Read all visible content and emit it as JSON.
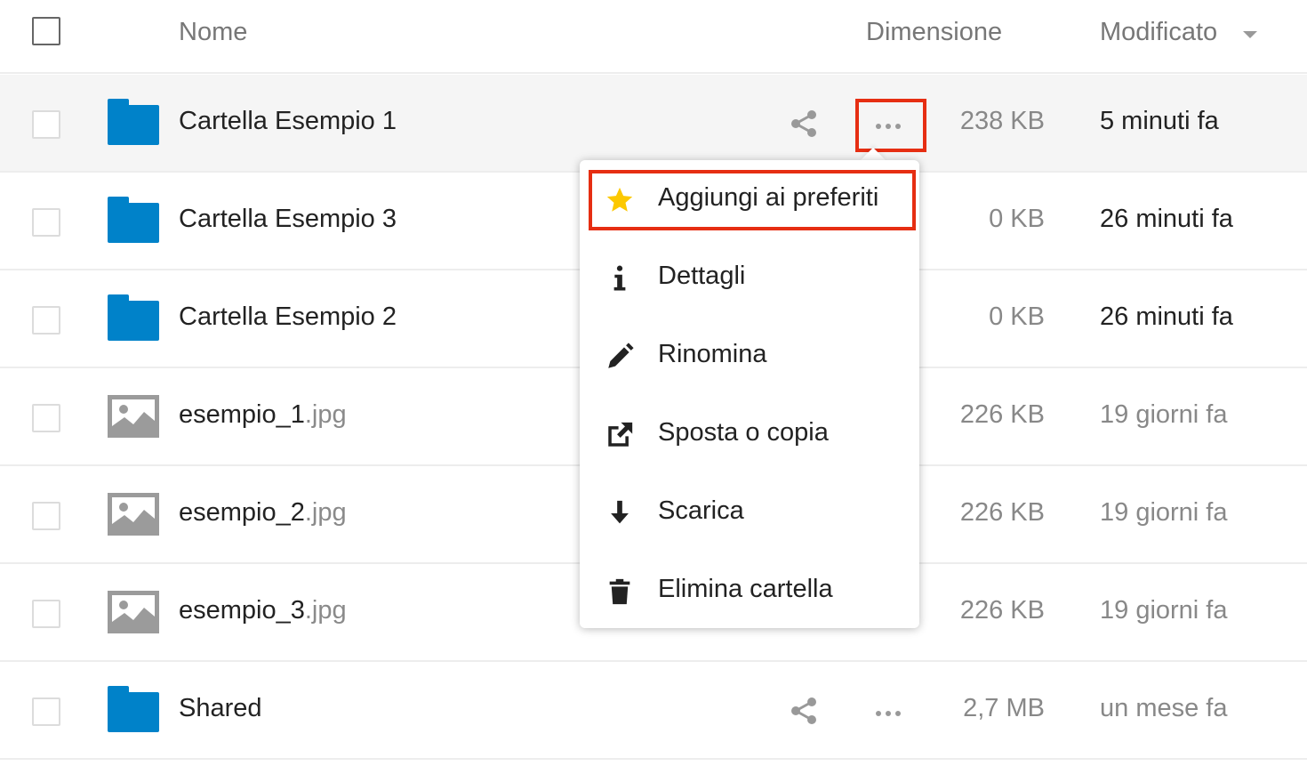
{
  "header": {
    "name": "Nome",
    "size": "Dimensione",
    "modified": "Modificato"
  },
  "rows": [
    {
      "name": "Cartella Esempio 1",
      "ext": "",
      "type": "folder",
      "size": "238 KB",
      "modified": "5 minuti fa"
    },
    {
      "name": "Cartella Esempio 3",
      "ext": "",
      "type": "folder",
      "size": "0 KB",
      "modified": "26 minuti fa"
    },
    {
      "name": "Cartella Esempio 2",
      "ext": "",
      "type": "folder",
      "size": "0 KB",
      "modified": "26 minuti fa"
    },
    {
      "name": "esempio_1",
      "ext": ".jpg",
      "type": "image",
      "size": "226 KB",
      "modified": "19 giorni fa"
    },
    {
      "name": "esempio_2",
      "ext": ".jpg",
      "type": "image",
      "size": "226 KB",
      "modified": "19 giorni fa"
    },
    {
      "name": "esempio_3",
      "ext": ".jpg",
      "type": "image",
      "size": "226 KB",
      "modified": "19 giorni fa"
    },
    {
      "name": "Shared",
      "ext": "",
      "type": "folder",
      "size": "2,7 MB",
      "modified": "un mese fa"
    }
  ],
  "menu": {
    "items": [
      {
        "label": "Aggiungi ai preferiti",
        "icon": "star-icon"
      },
      {
        "label": "Dettagli",
        "icon": "info-icon"
      },
      {
        "label": "Rinomina",
        "icon": "pencil-icon"
      },
      {
        "label": "Sposta o copia",
        "icon": "external-link-icon"
      },
      {
        "label": "Scarica",
        "icon": "download-arrow-icon"
      },
      {
        "label": "Elimina cartella",
        "icon": "trash-icon"
      }
    ]
  },
  "colors": {
    "folder": "#0082c9",
    "highlight": "#e62e12",
    "star": "#fcc800"
  }
}
